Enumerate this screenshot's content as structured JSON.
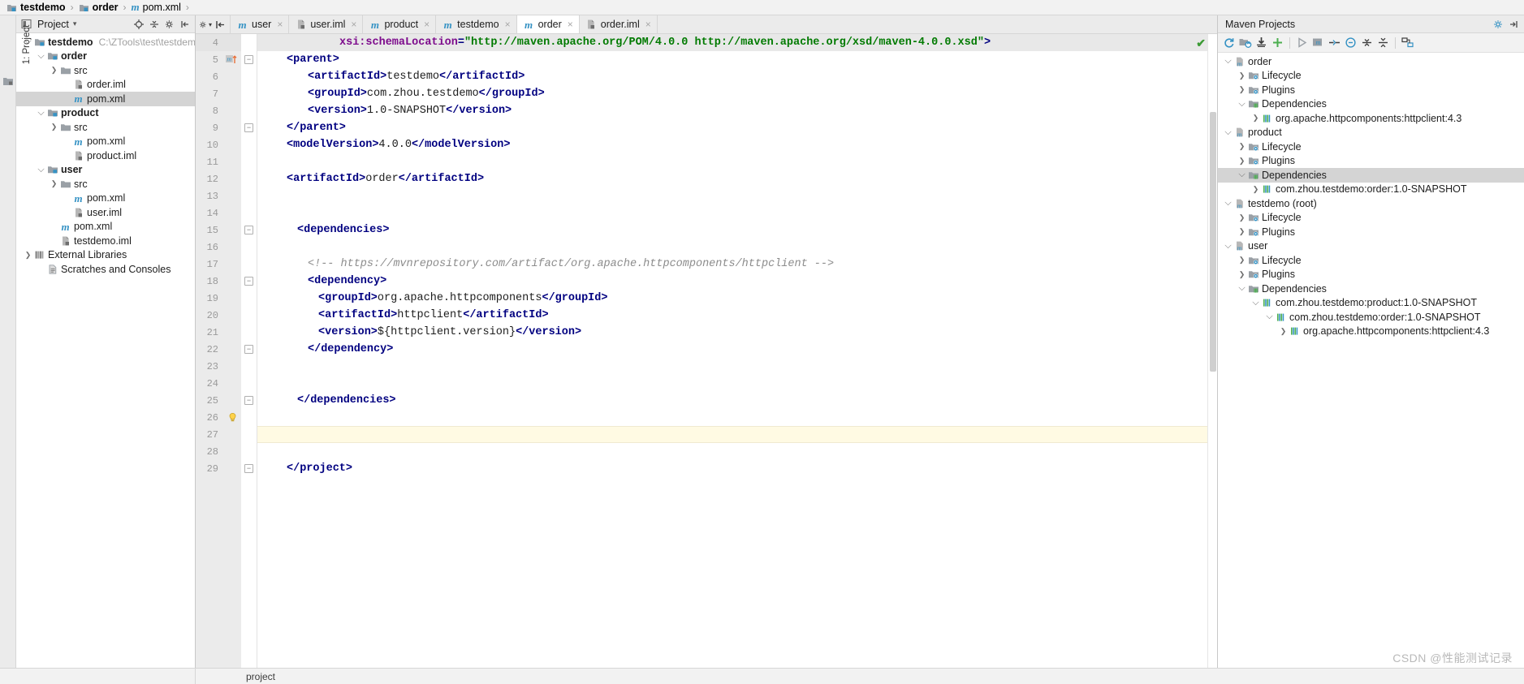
{
  "breadcrumb": {
    "items": [
      {
        "label": "testdemo",
        "icon": "module-folder-icon",
        "bold": true
      },
      {
        "label": "order",
        "icon": "module-folder-icon",
        "bold": true
      },
      {
        "label": "pom.xml",
        "icon": "maven-m-icon",
        "bold": false
      }
    ],
    "separator": "›"
  },
  "left_strip": {
    "tab_label": "1: Project",
    "icon": "project-tool-icon"
  },
  "project_panel": {
    "title": "Project",
    "dropdown_arrow": "▾",
    "toolbar_icons": [
      "locate-icon",
      "collapse-all-icon",
      "settings-icon",
      "hide-icon"
    ],
    "tree": [
      {
        "depth": 0,
        "arrow": "⌄",
        "icon": "module-folder-icon",
        "label": "testdemo",
        "bold": true,
        "path": "C:\\ZTools\\test\\testdemo",
        "selected": false
      },
      {
        "depth": 1,
        "arrow": "⌄",
        "icon": "module-folder-icon",
        "label": "order",
        "bold": true,
        "path": "",
        "selected": false
      },
      {
        "depth": 2,
        "arrow": "›",
        "icon": "folder-icon",
        "label": "src",
        "bold": false,
        "path": "",
        "selected": false
      },
      {
        "depth": 3,
        "arrow": "",
        "icon": "iml-file-icon",
        "label": "order.iml",
        "bold": false,
        "path": "",
        "selected": false
      },
      {
        "depth": 3,
        "arrow": "",
        "icon": "maven-m-icon",
        "label": "pom.xml",
        "bold": false,
        "path": "",
        "selected": true
      },
      {
        "depth": 1,
        "arrow": "⌄",
        "icon": "module-folder-icon",
        "label": "product",
        "bold": true,
        "path": "",
        "selected": false
      },
      {
        "depth": 2,
        "arrow": "›",
        "icon": "folder-icon",
        "label": "src",
        "bold": false,
        "path": "",
        "selected": false
      },
      {
        "depth": 3,
        "arrow": "",
        "icon": "maven-m-icon",
        "label": "pom.xml",
        "bold": false,
        "path": "",
        "selected": false
      },
      {
        "depth": 3,
        "arrow": "",
        "icon": "iml-file-icon",
        "label": "product.iml",
        "bold": false,
        "path": "",
        "selected": false
      },
      {
        "depth": 1,
        "arrow": "⌄",
        "icon": "module-folder-icon",
        "label": "user",
        "bold": true,
        "path": "",
        "selected": false
      },
      {
        "depth": 2,
        "arrow": "›",
        "icon": "folder-icon",
        "label": "src",
        "bold": false,
        "path": "",
        "selected": false
      },
      {
        "depth": 3,
        "arrow": "",
        "icon": "maven-m-icon",
        "label": "pom.xml",
        "bold": false,
        "path": "",
        "selected": false
      },
      {
        "depth": 3,
        "arrow": "",
        "icon": "iml-file-icon",
        "label": "user.iml",
        "bold": false,
        "path": "",
        "selected": false
      },
      {
        "depth": 2,
        "arrow": "",
        "icon": "maven-m-icon",
        "label": "pom.xml",
        "bold": false,
        "path": "",
        "selected": false
      },
      {
        "depth": 2,
        "arrow": "",
        "icon": "iml-file-icon",
        "label": "testdemo.iml",
        "bold": false,
        "path": "",
        "selected": false
      },
      {
        "depth": 0,
        "arrow": "›",
        "icon": "library-icon",
        "label": "External Libraries",
        "bold": false,
        "path": "",
        "selected": false
      },
      {
        "depth": 1,
        "arrow": "",
        "icon": "scratches-icon",
        "label": "Scratches and Consoles",
        "bold": false,
        "path": "",
        "selected": false
      }
    ]
  },
  "editor": {
    "tools": [
      "settings-icon",
      "expand-entry-points-icon"
    ],
    "tabs": [
      {
        "label": "user",
        "icon": "maven-m-icon",
        "active": false,
        "close": "×"
      },
      {
        "label": "user.iml",
        "icon": "iml-file-icon",
        "active": false,
        "close": "×"
      },
      {
        "label": "product",
        "icon": "maven-m-icon",
        "active": false,
        "close": "×"
      },
      {
        "label": "testdemo",
        "icon": "maven-m-icon",
        "active": false,
        "close": "×"
      },
      {
        "label": "order",
        "icon": "maven-m-icon",
        "active": true,
        "close": "×"
      },
      {
        "label": "order.iml",
        "icon": "iml-file-icon",
        "active": false,
        "close": "×"
      }
    ],
    "inspection_ok": "✔",
    "lines": [
      {
        "num": "4",
        "indent": 7,
        "fold": "",
        "marker": "",
        "highlight": true,
        "parts": [
          {
            "t": "attr",
            "s": "xsi:schemaLocation"
          },
          {
            "t": "tag",
            "s": "="
          },
          {
            "t": "str",
            "s": "\"http://maven.apache.org/POM/4.0.0 http://maven.apache.org/xsd/maven-4.0.0.xsd\""
          },
          {
            "t": "tag",
            "s": ">"
          }
        ]
      },
      {
        "num": "5",
        "indent": 2,
        "fold": "-",
        "marker": "maven-m-icon",
        "parts": [
          {
            "t": "tag",
            "s": "<parent>"
          }
        ]
      },
      {
        "num": "6",
        "indent": 4,
        "fold": "",
        "parts": [
          {
            "t": "tag",
            "s": "<artifactId>"
          },
          {
            "t": "txt",
            "s": "testdemo"
          },
          {
            "t": "tag",
            "s": "</artifactId>"
          }
        ]
      },
      {
        "num": "7",
        "indent": 4,
        "fold": "",
        "parts": [
          {
            "t": "tag",
            "s": "<groupId>"
          },
          {
            "t": "txt",
            "s": "com.zhou.testdemo"
          },
          {
            "t": "tag",
            "s": "</groupId>"
          }
        ]
      },
      {
        "num": "8",
        "indent": 4,
        "fold": "",
        "parts": [
          {
            "t": "tag",
            "s": "<version>"
          },
          {
            "t": "txt",
            "s": "1.0-SNAPSHOT"
          },
          {
            "t": "tag",
            "s": "</version>"
          }
        ]
      },
      {
        "num": "9",
        "indent": 2,
        "fold": "-",
        "parts": [
          {
            "t": "tag",
            "s": "</parent>"
          }
        ]
      },
      {
        "num": "10",
        "indent": 2,
        "fold": "",
        "parts": [
          {
            "t": "tag",
            "s": "<modelVersion>"
          },
          {
            "t": "txt",
            "s": "4.0.0"
          },
          {
            "t": "tag",
            "s": "</modelVersion>"
          }
        ]
      },
      {
        "num": "11",
        "indent": 2,
        "fold": "",
        "parts": []
      },
      {
        "num": "12",
        "indent": 2,
        "fold": "",
        "parts": [
          {
            "t": "tag",
            "s": "<artifactId>"
          },
          {
            "t": "txt",
            "s": "order"
          },
          {
            "t": "tag",
            "s": "</artifactId>"
          }
        ]
      },
      {
        "num": "13",
        "indent": 2,
        "fold": "",
        "parts": []
      },
      {
        "num": "14",
        "indent": 2,
        "fold": "",
        "parts": []
      },
      {
        "num": "15",
        "indent": 3,
        "fold": "-",
        "parts": [
          {
            "t": "tag",
            "s": "<dependencies>"
          }
        ]
      },
      {
        "num": "16",
        "indent": 3,
        "fold": "",
        "parts": []
      },
      {
        "num": "17",
        "indent": 4,
        "fold": "",
        "parts": [
          {
            "t": "cmt",
            "s": "<!-- https://mvnrepository.com/artifact/org.apache.httpcomponents/httpclient -->"
          }
        ]
      },
      {
        "num": "18",
        "indent": 4,
        "fold": "-",
        "parts": [
          {
            "t": "tag",
            "s": "<dependency>"
          }
        ]
      },
      {
        "num": "19",
        "indent": 5,
        "fold": "",
        "parts": [
          {
            "t": "tag",
            "s": "<groupId>"
          },
          {
            "t": "txt",
            "s": "org.apache.httpcomponents"
          },
          {
            "t": "tag",
            "s": "</groupId>"
          }
        ]
      },
      {
        "num": "20",
        "indent": 5,
        "fold": "",
        "parts": [
          {
            "t": "tag",
            "s": "<artifactId>"
          },
          {
            "t": "txt",
            "s": "httpclient"
          },
          {
            "t": "tag",
            "s": "</artifactId>"
          }
        ]
      },
      {
        "num": "21",
        "indent": 5,
        "fold": "",
        "parts": [
          {
            "t": "tag",
            "s": "<version>"
          },
          {
            "t": "txt",
            "s": "${httpclient.version}"
          },
          {
            "t": "tag",
            "s": "</version>"
          }
        ]
      },
      {
        "num": "22",
        "indent": 4,
        "fold": "-",
        "parts": [
          {
            "t": "tag",
            "s": "</dependency>"
          }
        ]
      },
      {
        "num": "23",
        "indent": 3,
        "fold": "",
        "parts": []
      },
      {
        "num": "24",
        "indent": 3,
        "fold": "",
        "parts": []
      },
      {
        "num": "25",
        "indent": 3,
        "fold": "-",
        "parts": [
          {
            "t": "tag",
            "s": "</dependencies>"
          }
        ]
      },
      {
        "num": "26",
        "indent": 2,
        "fold": "",
        "marker": "intention-bulb-icon",
        "parts": []
      },
      {
        "num": "27",
        "indent": 2,
        "fold": "",
        "caret": true,
        "parts": []
      },
      {
        "num": "28",
        "indent": 2,
        "fold": "",
        "parts": []
      },
      {
        "num": "29",
        "indent": 2,
        "fold": "-",
        "parts": [
          {
            "t": "tag",
            "s": "</project>"
          }
        ]
      }
    ]
  },
  "maven_panel": {
    "title": "Maven Projects",
    "settings_icon": "gear-icon",
    "toolbar_icons": [
      "reimport-icon",
      "generate-sources-icon",
      "download-sources-icon",
      "add-maven-project-icon",
      "run-icon",
      "execute-goal-icon",
      "toggle-offline-icon",
      "skip-tests-icon",
      "collapse-all-icon",
      "expand-icon",
      "show-diagram-icon"
    ],
    "tree": [
      {
        "depth": 0,
        "arrow": "⌄",
        "icon": "maven-module-icon",
        "label": "order",
        "selected": false
      },
      {
        "depth": 1,
        "arrow": "›",
        "icon": "lifecycle-folder-icon",
        "label": "Lifecycle",
        "selected": false
      },
      {
        "depth": 1,
        "arrow": "›",
        "icon": "plugins-folder-icon",
        "label": "Plugins",
        "selected": false
      },
      {
        "depth": 1,
        "arrow": "⌄",
        "icon": "dependencies-folder-icon",
        "label": "Dependencies",
        "selected": false
      },
      {
        "depth": 2,
        "arrow": "›",
        "icon": "dependency-icon",
        "label": "org.apache.httpcomponents:httpclient:4.3",
        "selected": false
      },
      {
        "depth": 0,
        "arrow": "⌄",
        "icon": "maven-module-icon",
        "label": "product",
        "selected": false
      },
      {
        "depth": 1,
        "arrow": "›",
        "icon": "lifecycle-folder-icon",
        "label": "Lifecycle",
        "selected": false
      },
      {
        "depth": 1,
        "arrow": "›",
        "icon": "plugins-folder-icon",
        "label": "Plugins",
        "selected": false
      },
      {
        "depth": 1,
        "arrow": "⌄",
        "icon": "dependencies-folder-icon",
        "label": "Dependencies",
        "selected": true
      },
      {
        "depth": 2,
        "arrow": "›",
        "icon": "dependency-icon",
        "label": "com.zhou.testdemo:order:1.0-SNAPSHOT",
        "selected": false
      },
      {
        "depth": 0,
        "arrow": "⌄",
        "icon": "maven-module-icon",
        "label": "testdemo (root)",
        "selected": false
      },
      {
        "depth": 1,
        "arrow": "›",
        "icon": "lifecycle-folder-icon",
        "label": "Lifecycle",
        "selected": false
      },
      {
        "depth": 1,
        "arrow": "›",
        "icon": "plugins-folder-icon",
        "label": "Plugins",
        "selected": false
      },
      {
        "depth": 0,
        "arrow": "⌄",
        "icon": "maven-module-icon",
        "label": "user",
        "selected": false
      },
      {
        "depth": 1,
        "arrow": "›",
        "icon": "lifecycle-folder-icon",
        "label": "Lifecycle",
        "selected": false
      },
      {
        "depth": 1,
        "arrow": "›",
        "icon": "plugins-folder-icon",
        "label": "Plugins",
        "selected": false
      },
      {
        "depth": 1,
        "arrow": "⌄",
        "icon": "dependencies-folder-icon",
        "label": "Dependencies",
        "selected": false
      },
      {
        "depth": 2,
        "arrow": "⌄",
        "icon": "dependency-icon",
        "label": "com.zhou.testdemo:product:1.0-SNAPSHOT",
        "selected": false
      },
      {
        "depth": 3,
        "arrow": "⌄",
        "icon": "dependency-icon",
        "label": "com.zhou.testdemo:order:1.0-SNAPSHOT",
        "selected": false
      },
      {
        "depth": 4,
        "arrow": "›",
        "icon": "dependency-icon",
        "label": "org.apache.httpcomponents:httpclient:4.3",
        "selected": false
      }
    ]
  },
  "statusbar": {
    "text": "project"
  },
  "watermark": {
    "text": "CSDN @性能测试记录"
  },
  "colors": {
    "accent_blue": "#3592c4",
    "tag_navy": "#000080",
    "attr_purple": "#7d0b8c",
    "string_green": "#007a00",
    "comment_gray": "#8c8c8c",
    "selection_gray": "#d4d4d4",
    "caret_line": "#fffae3",
    "panel_bg": "#f2f2f2"
  }
}
